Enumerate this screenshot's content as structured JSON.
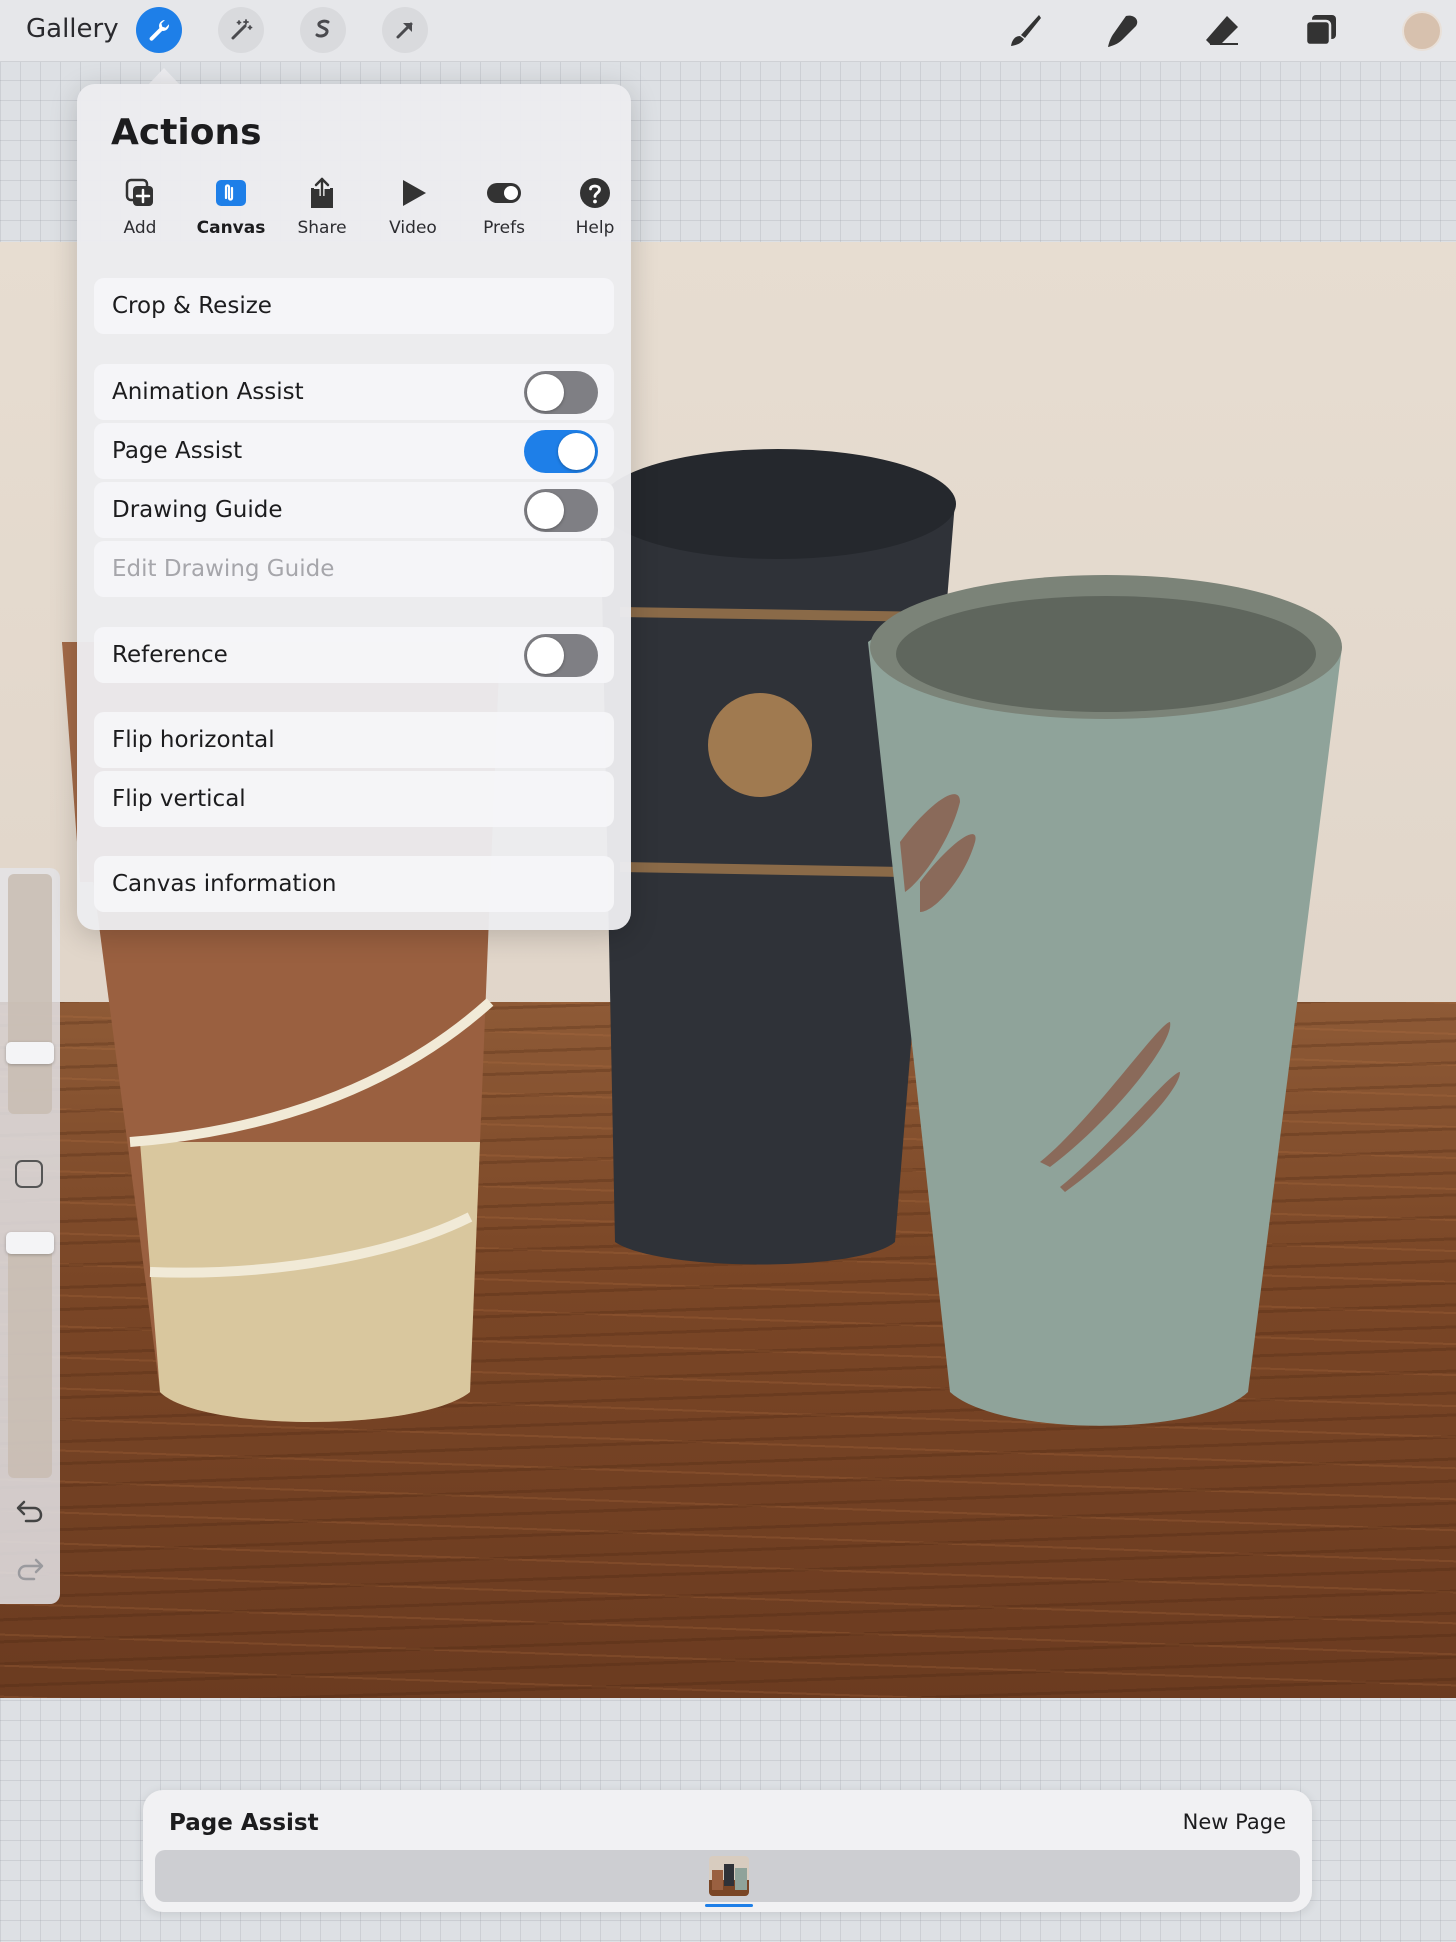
{
  "toolbar": {
    "gallery_label": "Gallery",
    "left_tools": [
      {
        "name": "actions",
        "icon": "wrench-icon",
        "active": true
      },
      {
        "name": "adjustments",
        "icon": "magic-wand-icon",
        "active": false
      },
      {
        "name": "selection",
        "icon": "selection-s-icon",
        "active": false
      },
      {
        "name": "transform",
        "icon": "arrow-cursor-icon",
        "active": false
      }
    ],
    "right_tools": [
      {
        "name": "paint",
        "icon": "brush-icon"
      },
      {
        "name": "smudge",
        "icon": "smudge-icon"
      },
      {
        "name": "erase",
        "icon": "eraser-icon"
      },
      {
        "name": "layers",
        "icon": "layers-icon"
      }
    ],
    "current_color": "#d7c1ae",
    "accent_color": "#1e7fe8"
  },
  "actions": {
    "title": "Actions",
    "tabs": [
      {
        "label": "Add",
        "icon": "add-copy-icon"
      },
      {
        "label": "Canvas",
        "icon": "canvas-icon",
        "active": true
      },
      {
        "label": "Share",
        "icon": "share-icon"
      },
      {
        "label": "Video",
        "icon": "play-icon"
      },
      {
        "label": "Prefs",
        "icon": "toggle-icon"
      },
      {
        "label": "Help",
        "icon": "help-icon"
      }
    ],
    "items": {
      "crop_resize": "Crop & Resize",
      "animation_assist": {
        "label": "Animation Assist",
        "on": false
      },
      "page_assist": {
        "label": "Page Assist",
        "on": true
      },
      "drawing_guide": {
        "label": "Drawing Guide",
        "on": false
      },
      "edit_drawing_guide": "Edit Drawing Guide",
      "reference": {
        "label": "Reference",
        "on": false
      },
      "flip_horizontal": "Flip horizontal",
      "flip_vertical": "Flip vertical",
      "canvas_information": "Canvas information"
    }
  },
  "page_assist_bar": {
    "title": "Page Assist",
    "new_page_label": "New Page",
    "pages": 1,
    "selected_page": 1
  }
}
